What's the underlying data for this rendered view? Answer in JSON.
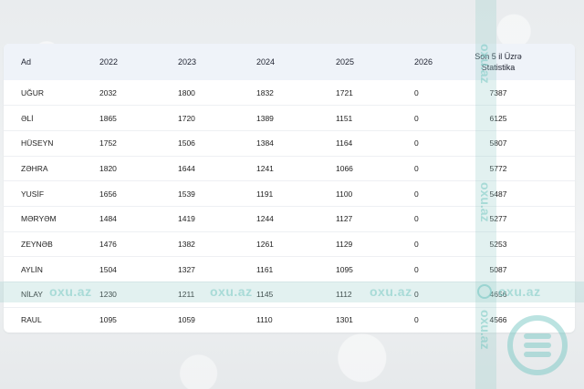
{
  "table": {
    "headers": [
      "Ad",
      "2022",
      "2023",
      "2024",
      "2025",
      "2026",
      "Son 5 il Üzrə Statistika"
    ],
    "rows": [
      [
        "UĞUR",
        "2032",
        "1800",
        "1832",
        "1721",
        "0",
        "7387"
      ],
      [
        "ƏLİ",
        "1865",
        "1720",
        "1389",
        "1151",
        "0",
        "6125"
      ],
      [
        "HÜSEYN",
        "1752",
        "1506",
        "1384",
        "1164",
        "0",
        "5807"
      ],
      [
        "ZƏHRA",
        "1820",
        "1644",
        "1241",
        "1066",
        "0",
        "5772"
      ],
      [
        "YUSİF",
        "1656",
        "1539",
        "1191",
        "1100",
        "0",
        "5487"
      ],
      [
        "MƏRYƏM",
        "1484",
        "1419",
        "1244",
        "1127",
        "0",
        "5277"
      ],
      [
        "ZEYNƏB",
        "1476",
        "1382",
        "1261",
        "1129",
        "0",
        "5253"
      ],
      [
        "AYLİN",
        "1504",
        "1327",
        "1161",
        "1095",
        "0",
        "5087"
      ],
      [
        "NİLAY",
        "1230",
        "1211",
        "1145",
        "1112",
        "0",
        "4656"
      ],
      [
        "RAUL",
        "1095",
        "1059",
        "1110",
        "1301",
        "0",
        "4566"
      ]
    ]
  },
  "watermark": {
    "text": "oxu.az",
    "color": "#78c8c3"
  }
}
